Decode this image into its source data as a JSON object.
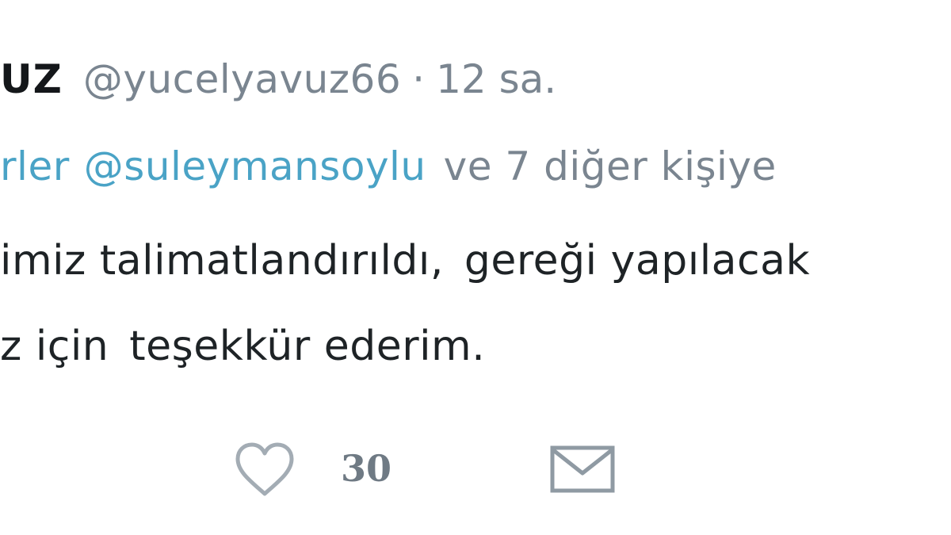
{
  "tweet": {
    "author_name": "UZ",
    "handle": "@yucelyavuz66",
    "separator": "·",
    "time": "12 sa.",
    "reply_prefix": "rler",
    "reply_mention": "@suleymansoylu",
    "reply_others": "ve 7 diğer kişiye",
    "body_line1_part1": "imiz talimatlandırıldı,",
    "body_line1_part2": "gereği yapılacak",
    "body_line2_part1": "z için",
    "body_line2_part2": "teşekkür ederim.",
    "mention_color": "#4aa3c6"
  },
  "actions": {
    "like_icon": "heart-icon",
    "like_count": "30",
    "dm_icon": "envelope-icon"
  }
}
